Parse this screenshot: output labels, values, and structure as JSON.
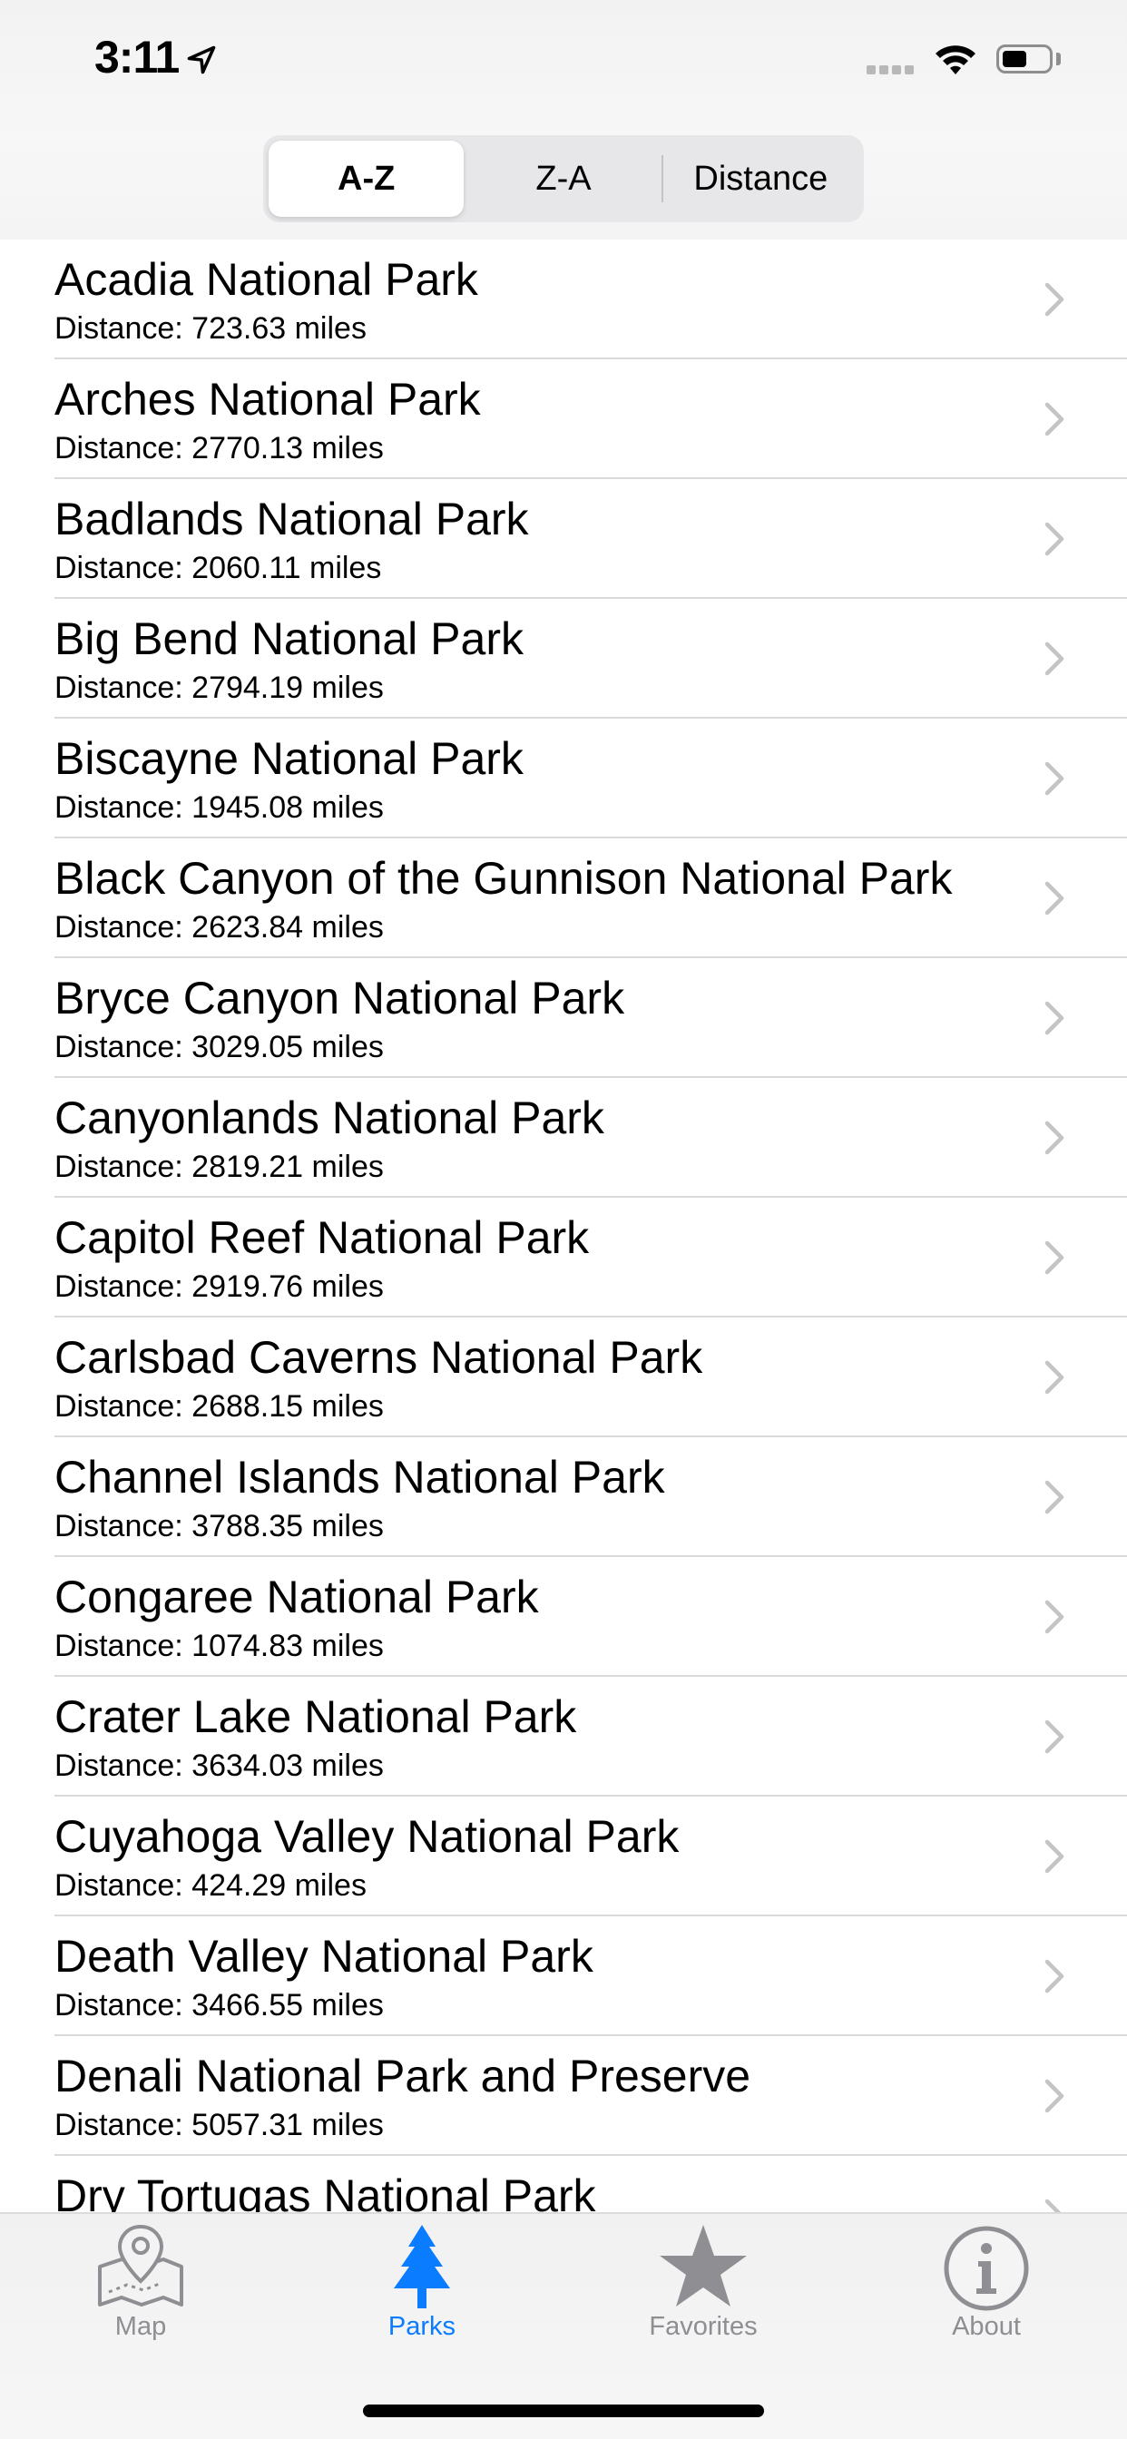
{
  "status_bar": {
    "time": "3:11"
  },
  "segmented": {
    "options": [
      "A-Z",
      "Z-A",
      "Distance"
    ],
    "selected": "A-Z"
  },
  "parks": [
    {
      "name": "Acadia National Park",
      "distance": "Distance: 723.63 miles"
    },
    {
      "name": "Arches National Park",
      "distance": "Distance: 2770.13 miles"
    },
    {
      "name": "Badlands National Park",
      "distance": "Distance: 2060.11 miles"
    },
    {
      "name": "Big Bend National Park",
      "distance": "Distance: 2794.19 miles"
    },
    {
      "name": "Biscayne National Park",
      "distance": "Distance: 1945.08 miles"
    },
    {
      "name": "Black Canyon of the Gunnison National Park",
      "distance": "Distance: 2623.84 miles"
    },
    {
      "name": "Bryce Canyon National Park",
      "distance": "Distance: 3029.05 miles"
    },
    {
      "name": "Canyonlands National Park",
      "distance": "Distance: 2819.21 miles"
    },
    {
      "name": "Capitol Reef National Park",
      "distance": "Distance: 2919.76 miles"
    },
    {
      "name": "Carlsbad Caverns National Park",
      "distance": "Distance: 2688.15 miles"
    },
    {
      "name": "Channel Islands National Park",
      "distance": "Distance: 3788.35 miles"
    },
    {
      "name": "Congaree National Park",
      "distance": "Distance: 1074.83 miles"
    },
    {
      "name": "Crater Lake National Park",
      "distance": "Distance: 3634.03 miles"
    },
    {
      "name": "Cuyahoga Valley National Park",
      "distance": "Distance: 424.29 miles"
    },
    {
      "name": "Death Valley National Park",
      "distance": "Distance: 3466.55 miles"
    },
    {
      "name": "Denali National Park and Preserve",
      "distance": "Distance: 5057.31 miles"
    },
    {
      "name": "Dry Tortugas National Park",
      "distance": ""
    }
  ],
  "tabbar": {
    "tabs": [
      {
        "label": "Map",
        "icon": "map-icon"
      },
      {
        "label": "Parks",
        "icon": "tree-icon"
      },
      {
        "label": "Favorites",
        "icon": "star-icon"
      },
      {
        "label": "About",
        "icon": "info-icon"
      }
    ],
    "active": "Parks",
    "colors": {
      "active": "#0a7cff",
      "inactive": "#8e8e93"
    }
  }
}
